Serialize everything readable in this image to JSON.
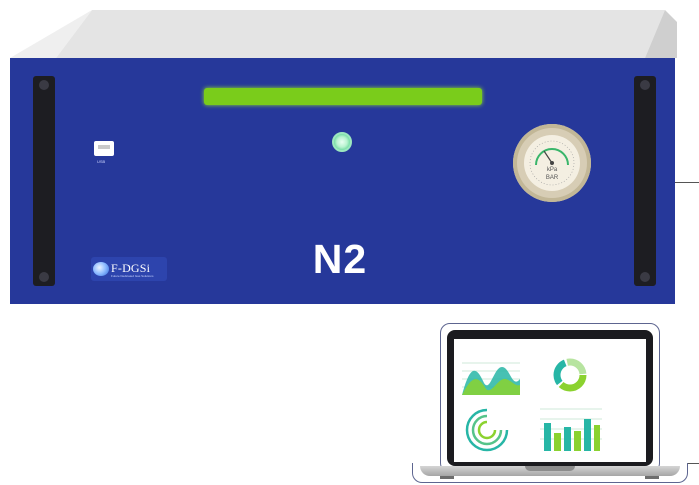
{
  "device": {
    "gas_label": "N2",
    "usb_label": "USB",
    "logo": {
      "text": "F-DGSi",
      "tagline": "Future Dedicated Gas Solutions"
    },
    "gauge": {
      "unit_top": "kPa",
      "unit_bottom": "BAR"
    }
  },
  "laptop": {
    "screen_icons": [
      "area-chart-icon",
      "donut-chart-icon",
      "radial-arcs-icon",
      "bar-chart-icon"
    ]
  },
  "colors": {
    "panel": "#26389a",
    "display_bar": "#7acc1b",
    "power_button": "#5fd496",
    "chart_green": "#8bd22f",
    "chart_teal": "#27b6a6"
  }
}
